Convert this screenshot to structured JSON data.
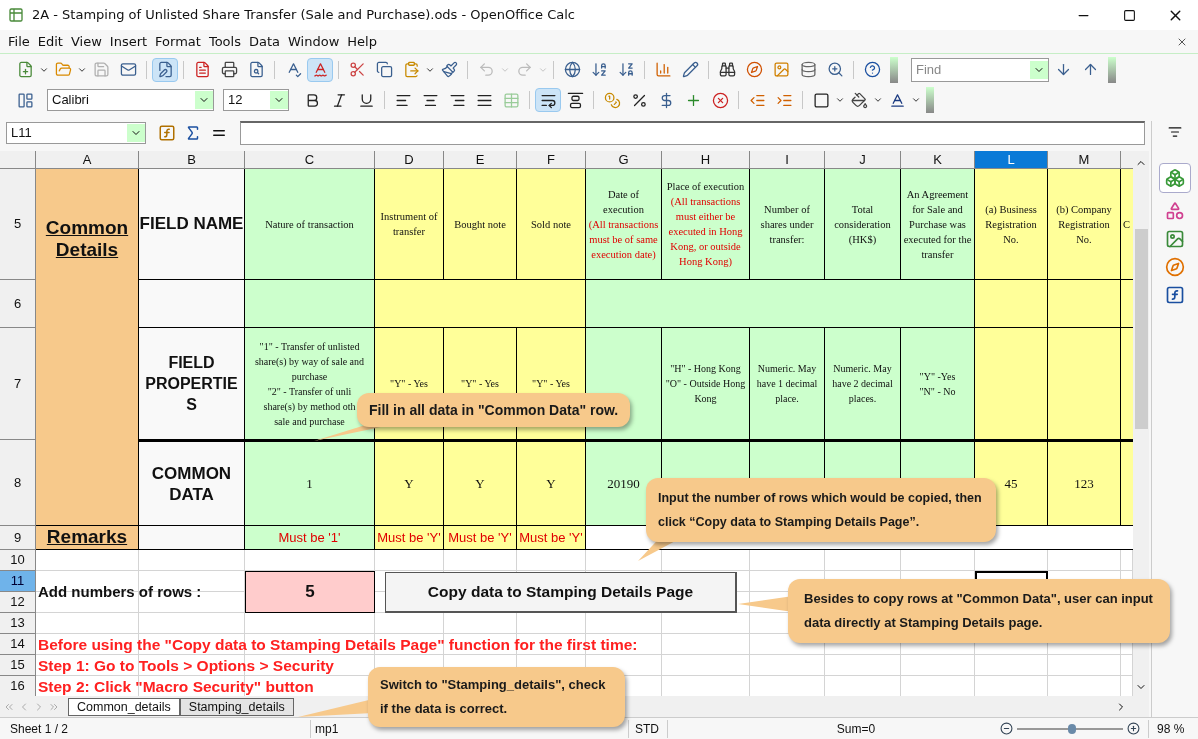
{
  "window": {
    "title": "2A - Stamping of Unlisted Share Transfer (Sale and Purchase).ods - OpenOffice Calc"
  },
  "menu": [
    "File",
    "Edit",
    "View",
    "Insert",
    "Format",
    "Tools",
    "Data",
    "Window",
    "Help"
  ],
  "toolbar": {
    "edit_mode": true,
    "auto_spellcheck": true,
    "find_placeholder": "Find"
  },
  "format_bar": {
    "font": "Calibri",
    "size": "12",
    "wrap_top": true
  },
  "formula_bar": {
    "cell": "L11"
  },
  "sheet": {
    "columns": [
      {
        "label": "A",
        "selected": false
      },
      {
        "label": "B",
        "selected": false
      },
      {
        "label": "C",
        "selected": false
      },
      {
        "label": "D",
        "selected": false
      },
      {
        "label": "E",
        "selected": false
      },
      {
        "label": "F",
        "selected": false
      },
      {
        "label": "G",
        "selected": false
      },
      {
        "label": "H",
        "selected": false
      },
      {
        "label": "I",
        "selected": false
      },
      {
        "label": "J",
        "selected": false
      },
      {
        "label": "K",
        "selected": false
      },
      {
        "label": "L",
        "selected": true
      },
      {
        "label": "M",
        "selected": false
      }
    ],
    "rows": [
      {
        "label": "5",
        "selected": false
      },
      {
        "label": "6",
        "selected": false
      },
      {
        "label": "7",
        "selected": false
      },
      {
        "label": "8",
        "selected": false
      },
      {
        "label": "9",
        "selected": false
      },
      {
        "label": "10",
        "selected": false
      },
      {
        "label": "11",
        "selected": true
      },
      {
        "label": "12",
        "selected": false
      },
      {
        "label": "13",
        "selected": false
      },
      {
        "label": "14",
        "selected": false
      },
      {
        "label": "15",
        "selected": false
      },
      {
        "label": "16",
        "selected": false
      }
    ],
    "section_title": "Common Details",
    "remarks_title": "Remarks",
    "field_name_label": "FIELD NAME",
    "field_properties_label": "FIELD PROPERTIES",
    "common_data_label": "COMMON DATA",
    "fields": [
      {
        "name": "Nature of transaction",
        "color": "#ccffcc",
        "properties": [
          "\"1\" - Transfer of unlisted",
          "share(s) by way of sale and",
          "purchase",
          "\"2\" -  Transfer of unli",
          "share(s) by method oth",
          "sale and purchase"
        ],
        "common": "1",
        "remark": "Must be '1'"
      },
      {
        "name": "Instrument of transfer",
        "color": "#ffff99",
        "properties": [
          "\"Y\" - Yes"
        ],
        "common": "Y",
        "remark": "Must be 'Y'"
      },
      {
        "name": "Bought note",
        "color": "#ffff99",
        "properties": [
          "\"Y\" - Yes"
        ],
        "common": "Y",
        "remark": "Must be 'Y'"
      },
      {
        "name": "Sold note",
        "color": "#ffff99",
        "properties": [
          "\"Y\" - Yes"
        ],
        "common": "Y",
        "remark": "Must be 'Y'"
      },
      {
        "name": "Date of execution",
        "note": "(All transactions must be of same execution date)",
        "color": "#ccffcc",
        "common": "20190"
      },
      {
        "name": "Place of execution",
        "note": "(All transactions must either be executed in Hong Kong, or outside Hong Kong)",
        "color": "#ccffcc",
        "properties": [
          "\"H\" - Hong Kong",
          "\"O\" - Outside Hong",
          "Kong"
        ]
      },
      {
        "name": "Number of shares under transfer:",
        "color": "#ccffcc",
        "properties": [
          "Numeric. May have 1 decimal place."
        ]
      },
      {
        "name": "Total consideration (HK$)",
        "color": "#ccffcc",
        "properties": [
          "Numeric.  May have 2 decimal places."
        ]
      },
      {
        "name": "An Agreement for Sale and Purchase was executed for the transfer",
        "color": "#ccffcc",
        "properties": [
          "\"Y\" -Yes",
          "\"N\" - No"
        ]
      },
      {
        "name": "(a)  Business Registration No.",
        "color": "#ffff99",
        "common": "45"
      },
      {
        "name": "(b) Company Registration No.",
        "color": "#ffff99",
        "common": "123"
      },
      {
        "name": "C",
        "color": "#ffff99"
      }
    ],
    "rows_label": "Add numbers of rows :",
    "rows_value": "5",
    "copy_button": "Copy data to Stamping Details Page",
    "instructions": [
      "Before using the \"Copy data to Stamping Details Page\" function for the first time:",
      "Step 1:  Go to Tools > Options > Security",
      "Step 2:  Click \"Macro Security\" button"
    ]
  },
  "callouts": [
    "Fill in all data in \"Common Data\" row.",
    "Input the number of rows which would be copied, then click “Copy data to Stamping Details Page”.",
    "Besides to copy rows at \"Common Data\", user can input data directly at Stamping Details page.",
    "Switch to \"Stamping_details\", check if the data is correct."
  ],
  "sheet_tabs": [
    {
      "label": "Common_details",
      "selected": true
    },
    {
      "label": "Stamping_details",
      "selected": false
    }
  ],
  "status_bar": {
    "sheet": "Sheet 1 / 2",
    "style": "mp1",
    "mode": "STD",
    "sum": "Sum=0",
    "zoom": "98 %",
    "level": 0.52
  }
}
